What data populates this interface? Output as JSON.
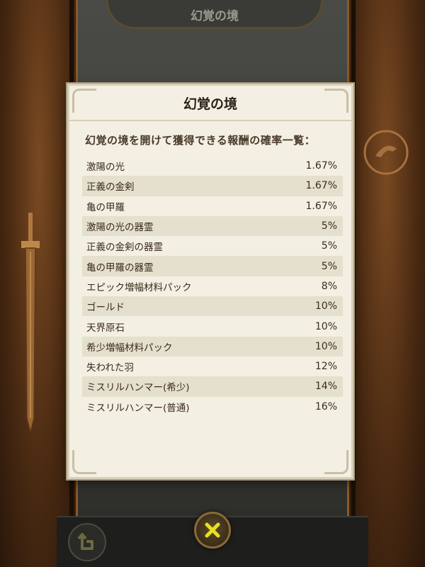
{
  "top_banner": {
    "title": "幻覚の境"
  },
  "dialog": {
    "title": "幻覚の境",
    "subtitle": "幻覚の境を開けて獲得できる報酬の確率一覧：",
    "rewards": [
      {
        "name": "激陽の光",
        "rate": "1.67%"
      },
      {
        "name": "正義の金剣",
        "rate": "1.67%"
      },
      {
        "name": "亀の甲羅",
        "rate": "1.67%"
      },
      {
        "name": "激陽の光の器霊",
        "rate": "5%"
      },
      {
        "name": "正義の金剣の器霊",
        "rate": "5%"
      },
      {
        "name": "亀の甲羅の器霊",
        "rate": "5%"
      },
      {
        "name": "エピック増幅材料パック",
        "rate": "8%"
      },
      {
        "name": "ゴールド",
        "rate": "10%"
      },
      {
        "name": "天界原石",
        "rate": "10%"
      },
      {
        "name": "希少増幅材料パック",
        "rate": "10%"
      },
      {
        "name": "失われた羽",
        "rate": "12%"
      },
      {
        "name": "ミスリルハンマー(希少)",
        "rate": "14%"
      },
      {
        "name": "ミスリルハンマー(普通)",
        "rate": "16%"
      }
    ]
  },
  "bottom_bar": {
    "back_icon": "back-arrow-icon",
    "close_icon": "close-x-icon"
  },
  "colors": {
    "dialog_bg": "#f3efe2",
    "row_alt": "#e5dfcd",
    "text": "#3a2c1e",
    "close_accent": "#e8e020"
  }
}
